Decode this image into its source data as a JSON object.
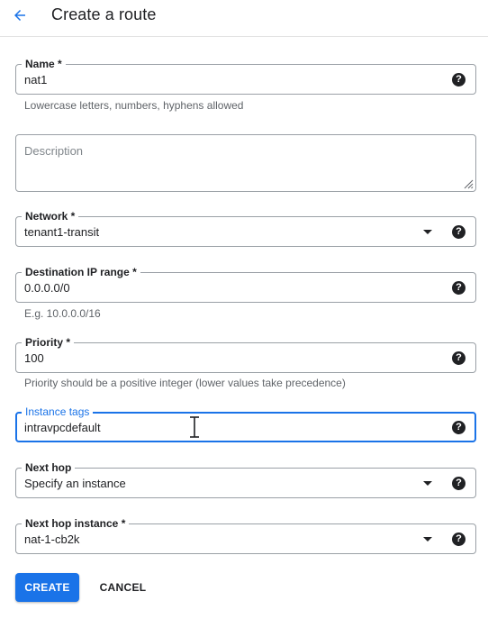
{
  "header": {
    "title": "Create a route",
    "back_icon": "arrow-back-icon"
  },
  "colors": {
    "accent": "#1a73e8",
    "border": "#9aa0a6",
    "hint": "#5f6368",
    "text": "#202124"
  },
  "form": {
    "name": {
      "label": "Name *",
      "value": "nat1",
      "hint": "Lowercase letters, numbers, hyphens allowed"
    },
    "description": {
      "placeholder": "Description",
      "value": ""
    },
    "network": {
      "label": "Network *",
      "value": "tenant1-transit"
    },
    "destination": {
      "label": "Destination IP range *",
      "value": "0.0.0.0/0",
      "hint": "E.g. 10.0.0.0/16"
    },
    "priority": {
      "label": "Priority *",
      "value": "100",
      "hint": "Priority should be a positive integer (lower values take precedence)"
    },
    "instance_tags": {
      "label": "Instance tags",
      "value": "intravpcdefault"
    },
    "next_hop": {
      "label": "Next hop",
      "value": "Specify an instance"
    },
    "next_hop_instance": {
      "label": "Next hop instance *",
      "value": "nat-1-cb2k"
    },
    "help_glyph": "?"
  },
  "actions": {
    "create_label": "CREATE",
    "cancel_label": "CANCEL"
  }
}
